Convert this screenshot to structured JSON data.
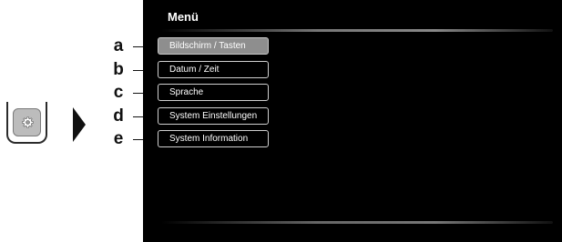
{
  "screen": {
    "title": "Menü"
  },
  "menu": {
    "items": [
      {
        "letter": "a",
        "label": "Bildschirm / Tasten",
        "selected": true
      },
      {
        "letter": "b",
        "label": "Datum / Zeit",
        "selected": false
      },
      {
        "letter": "c",
        "label": "Sprache",
        "selected": false
      },
      {
        "letter": "d",
        "label": "System Einstellungen",
        "selected": false
      },
      {
        "letter": "e",
        "label": "System Information",
        "selected": false
      }
    ]
  },
  "icons": {
    "device_button": "gear-icon",
    "arrow": "play-arrow-icon"
  },
  "colors": {
    "screen_bg": "#000000",
    "selected_item_bg": "#8e8e8e",
    "item_border": "#d0d0d0"
  }
}
